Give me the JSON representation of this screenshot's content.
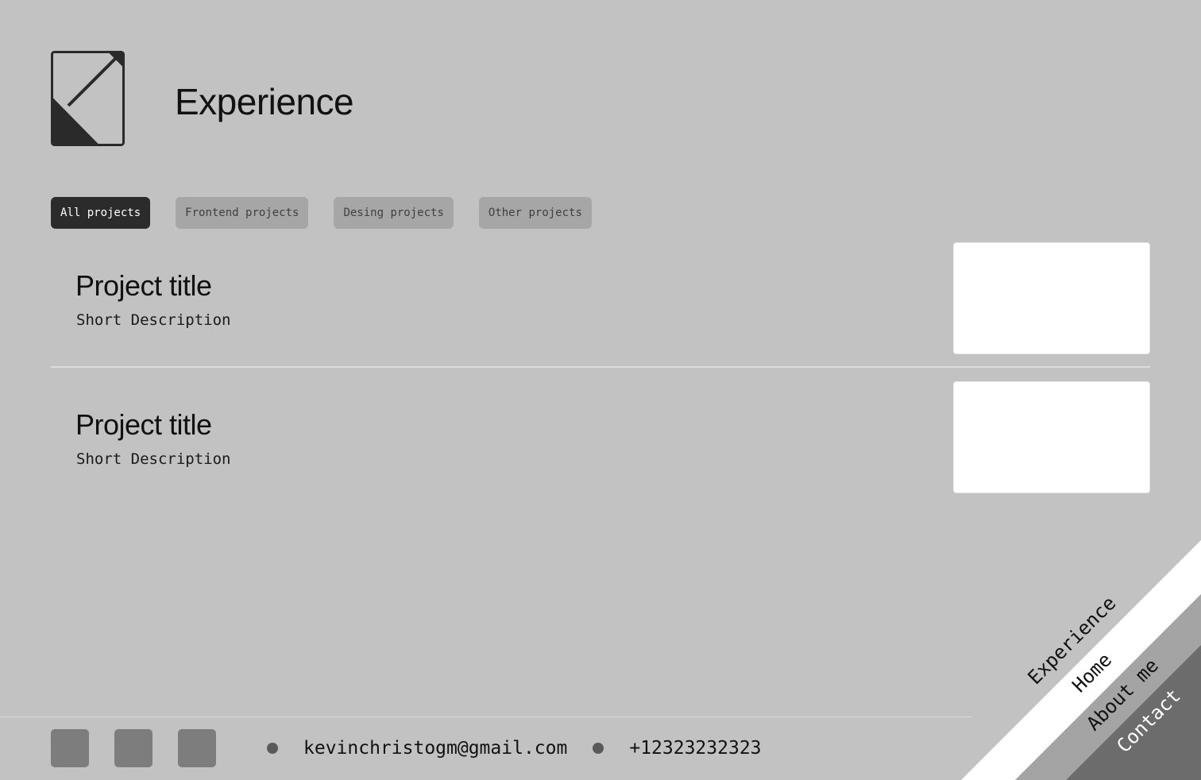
{
  "header": {
    "title": "Experience",
    "logo_icon": "arrow-square-logo-icon"
  },
  "filters": [
    {
      "label": "All projects",
      "active": true
    },
    {
      "label": "Frontend projects",
      "active": false
    },
    {
      "label": "Desing projects",
      "active": false
    },
    {
      "label": "Other projects",
      "active": false
    }
  ],
  "projects": [
    {
      "title": "Project title",
      "description": "Short Description"
    },
    {
      "title": "Project title",
      "description": "Short Description"
    }
  ],
  "footer": {
    "social_icons": [
      "social-icon-1",
      "social-icon-2",
      "social-icon-3"
    ],
    "email": "kevinchristogm@gmail.com",
    "phone": "+12323232323"
  },
  "corner_nav": {
    "items": [
      "Experience",
      "Home",
      "About me",
      "Contact"
    ]
  },
  "colors": {
    "background": "#c2c2c2",
    "active_filter": "#2b2b2b",
    "inactive_filter": "#a6a6a6",
    "card": "#ffffff"
  }
}
